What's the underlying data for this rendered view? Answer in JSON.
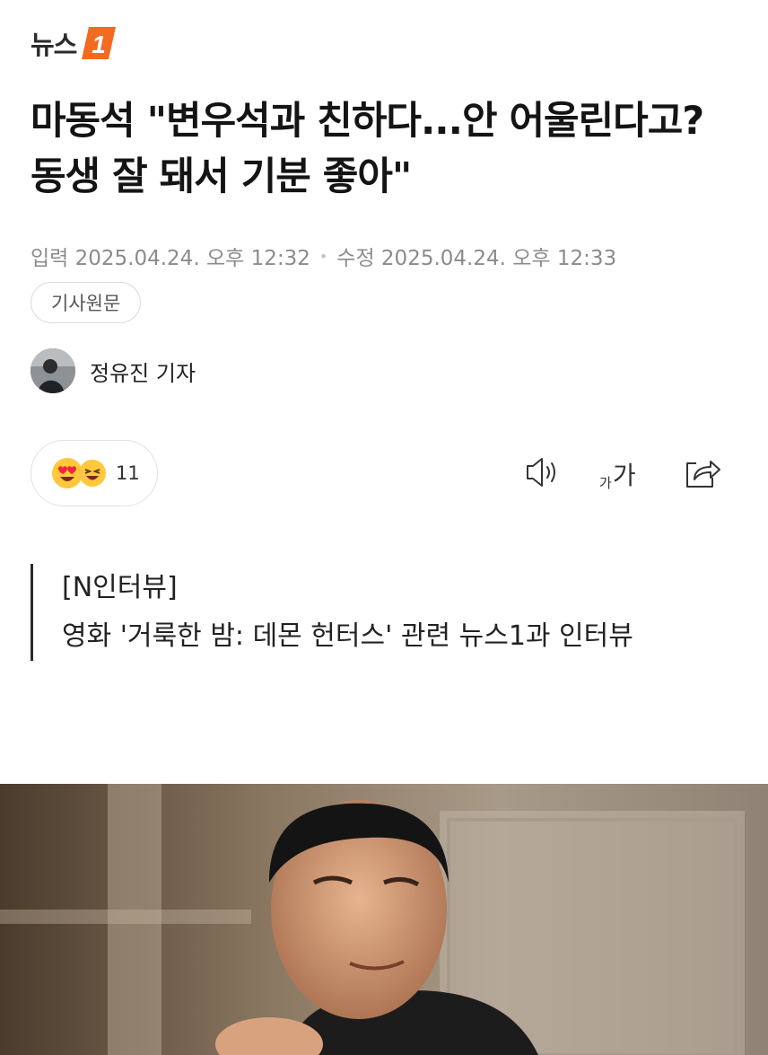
{
  "brand": {
    "name": "뉴스",
    "mark": "1",
    "accent_color": "#f26b21"
  },
  "article": {
    "headline": "마동석 \"변우석과 친하다...안 어울린다고? 동생 잘 돼서 기분 좋아\"",
    "published_label": "입력 2025.04.24. 오후 12:32",
    "updated_label": "수정 2025.04.24. 오후 12:33",
    "original_link_label": "기사원문",
    "reporter": "정유진 기자",
    "summary": [
      "[N인터뷰]",
      "영화 '거룩한 밤: 데몬 헌터스' 관련 뉴스1과 인터뷰"
    ]
  },
  "reactions": {
    "icons": [
      "heart-eyes-emoji",
      "laughing-emoji"
    ],
    "count": "11"
  },
  "toolbar": {
    "listen_icon": "speaker-icon",
    "font_small": "가",
    "font_big": "가",
    "share_icon": "share-icon"
  }
}
